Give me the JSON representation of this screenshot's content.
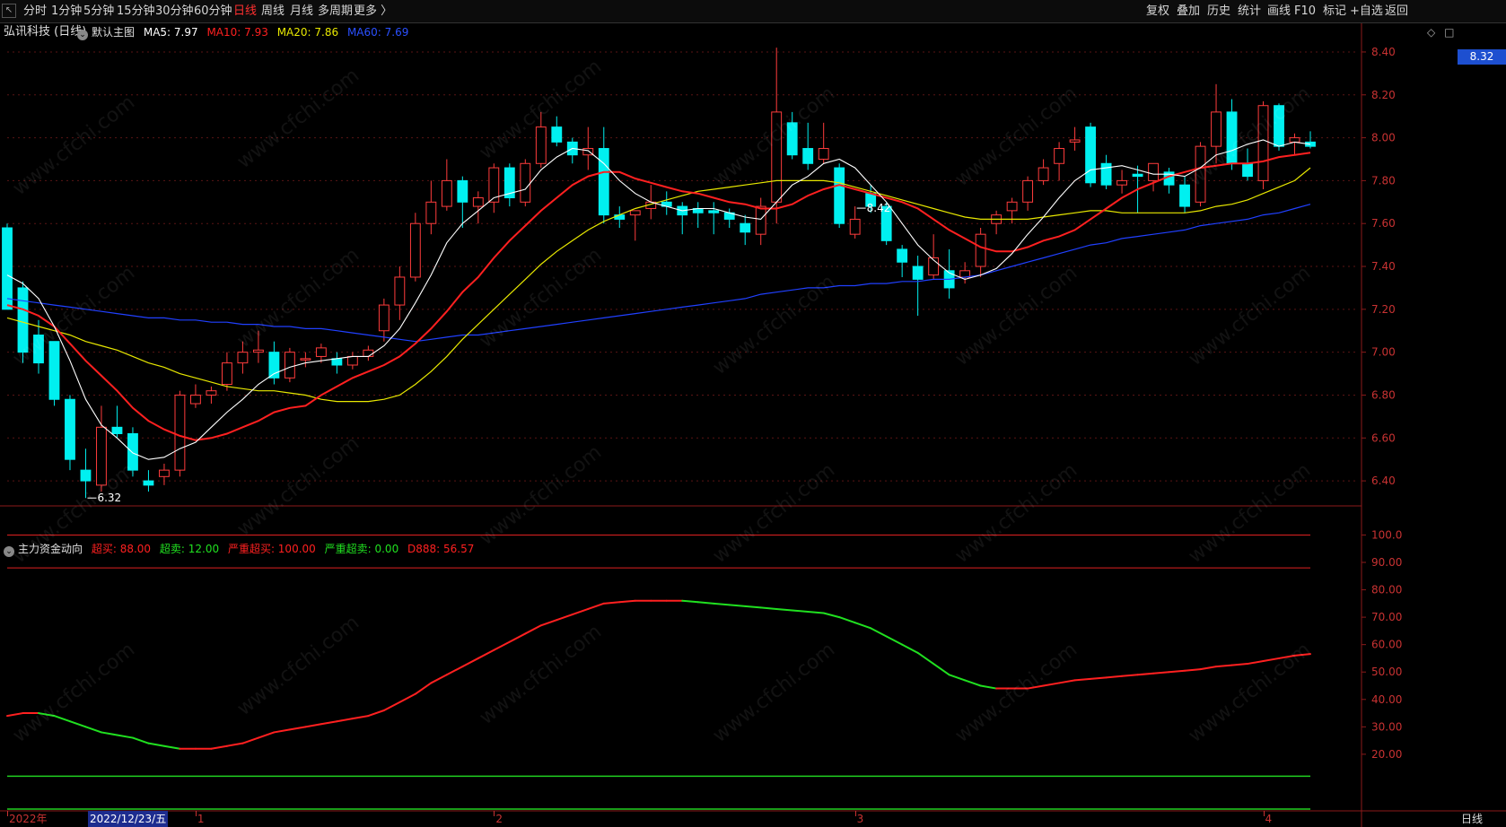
{
  "toolbar": {
    "back_icon": "back-arrow-icon",
    "periods": [
      "分时",
      "1分钟",
      "5分钟",
      "15分钟",
      "30分钟",
      "60分钟",
      "日线",
      "周线",
      "月线",
      "多周期",
      "更多 〉"
    ],
    "active_period": "日线",
    "right_tools": [
      "复权",
      "叠加",
      "历史",
      "统计",
      "画线",
      "F10",
      "标记",
      "+自选",
      "返回"
    ]
  },
  "stock": {
    "title": "弘讯科技 (日线)"
  },
  "main_legend": {
    "name": "默认主图",
    "ma5": "MA5: 7.97",
    "ma10": "MA10: 7.93",
    "ma20": "MA20: 7.86",
    "ma60": "MA60: 7.69",
    "colors": {
      "ma5": "#ffffff",
      "ma10": "#ff2020",
      "ma20": "#e8e800",
      "ma60": "#2040ff",
      "up": "#ff3c3c",
      "down": "#00f0f0"
    }
  },
  "sub_legend": {
    "name": "主力资金动向",
    "overbuy": "超买: 88.00",
    "oversell": "超卖: 12.00",
    "severe_overbuy": "严重超买: 100.00",
    "severe_oversell": "严重超卖: 0.00",
    "d888": "D888: 56.57"
  },
  "current_price": "8.32",
  "period_badge": "日线",
  "date_axis": {
    "cursor_label": "2022/12/23/五",
    "ticks": [
      {
        "label": "2022年",
        "index": 0
      },
      {
        "label": "1",
        "index": 12
      },
      {
        "label": "2",
        "index": 31
      },
      {
        "label": "3",
        "index": 54
      },
      {
        "label": "4",
        "index": 80
      }
    ]
  },
  "watermark_text": "www.cfchi.com",
  "chart_data": [
    {
      "type": "candlestick",
      "title": "弘讯科技 (日线)",
      "ylim": [
        6.3,
        8.45
      ],
      "yticks": [
        "8.40",
        "8.20",
        "8.00",
        "7.80",
        "7.60",
        "7.40",
        "7.20",
        "7.00",
        "6.80",
        "6.60",
        "6.40"
      ],
      "annotations": [
        {
          "text": "8.42",
          "index": 54
        },
        {
          "text": "6.32",
          "index": 5
        }
      ],
      "candles": [
        [
          7.58,
          7.6,
          7.25,
          7.2
        ],
        [
          7.3,
          7.33,
          6.95,
          7.0
        ],
        [
          7.08,
          7.15,
          6.9,
          6.95
        ],
        [
          7.05,
          7.05,
          6.75,
          6.78
        ],
        [
          6.78,
          6.8,
          6.45,
          6.5
        ],
        [
          6.45,
          6.55,
          6.32,
          6.4
        ],
        [
          6.38,
          6.75,
          6.35,
          6.65
        ],
        [
          6.65,
          6.75,
          6.6,
          6.62
        ],
        [
          6.62,
          6.65,
          6.42,
          6.45
        ],
        [
          6.4,
          6.45,
          6.35,
          6.38
        ],
        [
          6.42,
          6.48,
          6.38,
          6.45
        ],
        [
          6.45,
          6.82,
          6.42,
          6.8
        ],
        [
          6.76,
          6.85,
          6.74,
          6.8
        ],
        [
          6.8,
          6.84,
          6.76,
          6.82
        ],
        [
          6.85,
          7.0,
          6.82,
          6.95
        ],
        [
          6.95,
          7.05,
          6.9,
          7.0
        ],
        [
          7.0,
          7.1,
          6.95,
          7.01
        ],
        [
          7.0,
          7.05,
          6.85,
          6.88
        ],
        [
          6.88,
          7.02,
          6.86,
          7.0
        ],
        [
          6.97,
          7.0,
          6.93,
          6.97
        ],
        [
          6.98,
          7.04,
          6.95,
          7.02
        ],
        [
          6.97,
          7.0,
          6.9,
          6.94
        ],
        [
          6.94,
          7.0,
          6.92,
          6.98
        ],
        [
          6.98,
          7.03,
          6.96,
          7.01
        ],
        [
          7.1,
          7.25,
          7.05,
          7.22
        ],
        [
          7.22,
          7.4,
          7.15,
          7.35
        ],
        [
          7.35,
          7.65,
          7.33,
          7.6
        ],
        [
          7.6,
          7.8,
          7.55,
          7.7
        ],
        [
          7.68,
          7.9,
          7.66,
          7.8
        ],
        [
          7.8,
          7.82,
          7.58,
          7.7
        ],
        [
          7.68,
          7.75,
          7.6,
          7.72
        ],
        [
          7.7,
          7.88,
          7.65,
          7.86
        ],
        [
          7.86,
          7.88,
          7.68,
          7.72
        ],
        [
          7.7,
          7.9,
          7.68,
          7.88
        ],
        [
          7.88,
          8.12,
          7.86,
          8.05
        ],
        [
          8.05,
          8.1,
          7.96,
          7.98
        ],
        [
          7.98,
          8.0,
          7.88,
          7.92
        ],
        [
          7.92,
          8.05,
          7.85,
          7.95
        ],
        [
          7.95,
          8.05,
          7.6,
          7.64
        ],
        [
          7.64,
          7.68,
          7.58,
          7.62
        ],
        [
          7.64,
          7.66,
          7.52,
          7.66
        ],
        [
          7.67,
          7.78,
          7.62,
          7.7
        ],
        [
          7.7,
          7.75,
          7.64,
          7.68
        ],
        [
          7.68,
          7.7,
          7.55,
          7.64
        ],
        [
          7.67,
          7.7,
          7.58,
          7.65
        ],
        [
          7.66,
          7.7,
          7.55,
          7.65
        ],
        [
          7.65,
          7.67,
          7.58,
          7.62
        ],
        [
          7.6,
          7.64,
          7.5,
          7.56
        ],
        [
          7.55,
          7.72,
          7.5,
          7.68
        ],
        [
          7.7,
          8.42,
          7.6,
          8.12
        ],
        [
          8.07,
          8.12,
          7.9,
          7.92
        ],
        [
          7.95,
          8.07,
          7.85,
          7.88
        ],
        [
          7.9,
          8.07,
          7.88,
          7.95
        ],
        [
          7.86,
          7.88,
          7.58,
          7.6
        ],
        [
          7.55,
          7.68,
          7.53,
          7.62
        ],
        [
          7.74,
          7.78,
          7.65,
          7.68
        ],
        [
          7.68,
          7.7,
          7.5,
          7.52
        ],
        [
          7.48,
          7.5,
          7.35,
          7.42
        ],
        [
          7.4,
          7.45,
          7.17,
          7.34
        ],
        [
          7.36,
          7.55,
          7.34,
          7.44
        ],
        [
          7.38,
          7.48,
          7.25,
          7.3
        ],
        [
          7.35,
          7.42,
          7.32,
          7.38
        ],
        [
          7.4,
          7.58,
          7.35,
          7.55
        ],
        [
          7.6,
          7.66,
          7.55,
          7.64
        ],
        [
          7.66,
          7.72,
          7.6,
          7.7
        ],
        [
          7.7,
          7.82,
          7.66,
          7.8
        ],
        [
          7.8,
          7.9,
          7.78,
          7.86
        ],
        [
          7.88,
          7.98,
          7.8,
          7.95
        ],
        [
          7.98,
          8.05,
          7.94,
          7.99
        ],
        [
          8.05,
          8.07,
          7.77,
          7.79
        ],
        [
          7.88,
          7.92,
          7.76,
          7.78
        ],
        [
          7.78,
          7.85,
          7.74,
          7.8
        ],
        [
          7.83,
          7.87,
          7.65,
          7.82
        ],
        [
          7.8,
          7.85,
          7.75,
          7.88
        ],
        [
          7.84,
          7.86,
          7.74,
          7.78
        ],
        [
          7.78,
          7.82,
          7.65,
          7.68
        ],
        [
          7.7,
          7.98,
          7.68,
          7.96
        ],
        [
          7.96,
          8.25,
          7.88,
          8.12
        ],
        [
          8.12,
          8.18,
          7.85,
          7.88
        ],
        [
          7.88,
          7.95,
          7.8,
          7.82
        ],
        [
          7.8,
          8.17,
          7.76,
          8.15
        ],
        [
          8.15,
          8.16,
          7.94,
          7.96
        ],
        [
          7.98,
          8.02,
          7.92,
          8.0
        ],
        [
          7.98,
          8.03,
          7.95,
          7.96
        ]
      ],
      "ma5": [
        7.36,
        7.32,
        7.25,
        7.12,
        6.96,
        6.78,
        6.66,
        6.6,
        6.53,
        6.5,
        6.51,
        6.55,
        6.58,
        6.65,
        6.72,
        6.78,
        6.85,
        6.9,
        6.93,
        6.95,
        6.96,
        6.97,
        6.98,
        6.98,
        7.03,
        7.11,
        7.23,
        7.36,
        7.51,
        7.6,
        7.66,
        7.72,
        7.74,
        7.76,
        7.85,
        7.91,
        7.95,
        7.94,
        7.88,
        7.8,
        7.74,
        7.7,
        7.68,
        7.66,
        7.67,
        7.67,
        7.65,
        7.63,
        7.62,
        7.7,
        7.78,
        7.82,
        7.88,
        7.9,
        7.86,
        7.78,
        7.7,
        7.6,
        7.5,
        7.43,
        7.37,
        7.34,
        7.36,
        7.39,
        7.46,
        7.55,
        7.63,
        7.72,
        7.8,
        7.85,
        7.86,
        7.87,
        7.85,
        7.83,
        7.83,
        7.82,
        7.86,
        7.92,
        7.94,
        7.97,
        7.99,
        7.96,
        7.98,
        7.97
      ],
      "ma10": [
        7.22,
        7.2,
        7.17,
        7.12,
        7.04,
        6.96,
        6.89,
        6.82,
        6.74,
        6.68,
        6.64,
        6.61,
        6.59,
        6.6,
        6.62,
        6.65,
        6.68,
        6.72,
        6.74,
        6.75,
        6.8,
        6.84,
        6.88,
        6.91,
        6.94,
        6.98,
        7.04,
        7.11,
        7.19,
        7.28,
        7.35,
        7.44,
        7.52,
        7.59,
        7.66,
        7.72,
        7.78,
        7.82,
        7.84,
        7.84,
        7.81,
        7.79,
        7.77,
        7.75,
        7.74,
        7.72,
        7.7,
        7.69,
        7.67,
        7.67,
        7.69,
        7.73,
        7.76,
        7.78,
        7.76,
        7.74,
        7.72,
        7.7,
        7.67,
        7.62,
        7.57,
        7.53,
        7.49,
        7.47,
        7.47,
        7.49,
        7.52,
        7.54,
        7.57,
        7.62,
        7.67,
        7.72,
        7.76,
        7.79,
        7.82,
        7.84,
        7.86,
        7.87,
        7.88,
        7.88,
        7.89,
        7.91,
        7.92,
        7.93
      ],
      "ma20": [
        7.16,
        7.14,
        7.12,
        7.1,
        7.08,
        7.05,
        7.03,
        7.01,
        6.98,
        6.95,
        6.93,
        6.9,
        6.88,
        6.86,
        6.84,
        6.83,
        6.82,
        6.82,
        6.81,
        6.8,
        6.78,
        6.77,
        6.77,
        6.77,
        6.78,
        6.8,
        6.85,
        6.91,
        6.98,
        7.06,
        7.13,
        7.2,
        7.27,
        7.34,
        7.41,
        7.47,
        7.52,
        7.57,
        7.61,
        7.64,
        7.67,
        7.69,
        7.71,
        7.73,
        7.75,
        7.76,
        7.77,
        7.78,
        7.79,
        7.8,
        7.8,
        7.8,
        7.8,
        7.79,
        7.77,
        7.75,
        7.73,
        7.71,
        7.69,
        7.67,
        7.65,
        7.63,
        7.62,
        7.62,
        7.62,
        7.62,
        7.63,
        7.64,
        7.65,
        7.66,
        7.66,
        7.65,
        7.65,
        7.65,
        7.65,
        7.65,
        7.66,
        7.68,
        7.69,
        7.71,
        7.74,
        7.77,
        7.8,
        7.86
      ],
      "ma60": [
        7.25,
        7.24,
        7.23,
        7.22,
        7.21,
        7.2,
        7.19,
        7.18,
        7.17,
        7.16,
        7.16,
        7.15,
        7.15,
        7.14,
        7.14,
        7.13,
        7.13,
        7.12,
        7.12,
        7.11,
        7.11,
        7.1,
        7.09,
        7.08,
        7.07,
        7.06,
        7.05,
        7.06,
        7.07,
        7.08,
        7.08,
        7.09,
        7.1,
        7.11,
        7.12,
        7.13,
        7.14,
        7.15,
        7.16,
        7.17,
        7.18,
        7.19,
        7.2,
        7.21,
        7.22,
        7.23,
        7.24,
        7.25,
        7.27,
        7.28,
        7.29,
        7.3,
        7.3,
        7.31,
        7.31,
        7.32,
        7.32,
        7.33,
        7.33,
        7.34,
        7.34,
        7.35,
        7.36,
        7.38,
        7.4,
        7.42,
        7.44,
        7.46,
        7.48,
        7.5,
        7.51,
        7.53,
        7.54,
        7.55,
        7.56,
        7.57,
        7.59,
        7.6,
        7.61,
        7.62,
        7.64,
        7.65,
        7.67,
        7.69
      ]
    },
    {
      "type": "line",
      "title": "主力资金动向",
      "ylim": [
        0,
        108
      ],
      "yticks": [
        "100.0",
        "90.00",
        "80.00",
        "70.00",
        "60.00",
        "50.00",
        "40.00",
        "30.00",
        "20.00"
      ],
      "levels": {
        "severe_overbuy": 100,
        "overbuy": 88,
        "oversell": 12,
        "severe_oversell": 0
      },
      "d888": [
        34,
        35,
        35,
        34,
        32,
        30,
        28,
        27,
        26,
        24,
        23,
        22,
        22,
        22,
        23,
        24,
        26,
        28,
        29,
        30,
        31,
        32,
        33,
        34,
        36,
        39,
        42,
        46,
        49,
        52,
        55,
        58,
        61,
        64,
        67,
        69,
        71,
        73,
        75,
        75.5,
        76,
        76,
        76,
        76,
        75.5,
        75,
        74.5,
        74,
        73.5,
        73,
        72.5,
        72,
        71.5,
        70,
        68,
        66,
        63,
        60,
        57,
        53,
        49,
        47,
        45,
        44,
        44,
        44,
        45,
        46,
        47,
        47.5,
        48,
        48.5,
        49,
        49.5,
        50,
        50.5,
        51,
        52,
        52.5,
        53,
        54,
        55,
        56,
        56.57
      ]
    }
  ]
}
